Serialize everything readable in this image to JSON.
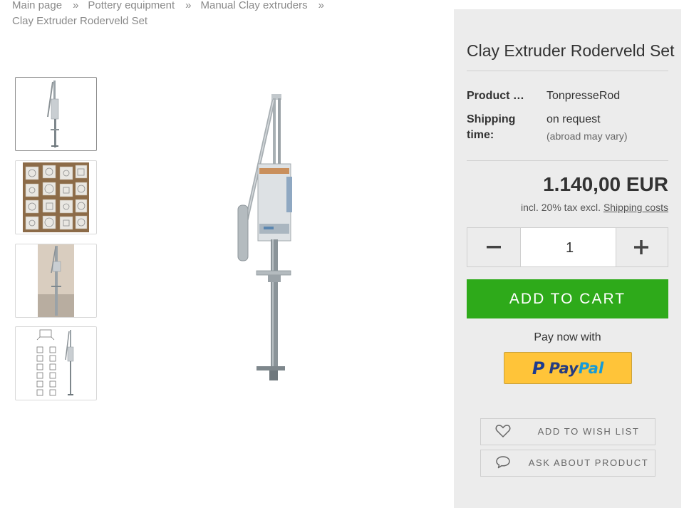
{
  "breadcrumb": {
    "items": [
      "Main page",
      "Pottery equipment",
      "Manual Clay extruders"
    ],
    "separator": "»",
    "current": "Clay Extruder Roderveld Set"
  },
  "gallery": {
    "thumbnails": [
      "extruder-photo",
      "dies-photo",
      "extruder-wall-photo",
      "extruder-with-dies-photo"
    ],
    "active_index": 0
  },
  "product": {
    "title": "Clay Extruder Roderveld Set",
    "product_label": "Product …",
    "product_value": "TonpresseRod",
    "shipping_label": "Shipping time:",
    "shipping_value": "on request",
    "shipping_note": "(abroad may vary)",
    "price": "1.140,00 EUR",
    "tax_text": "incl. 20% tax excl.",
    "shipping_costs_link": "Shipping costs"
  },
  "cart": {
    "quantity": "1",
    "minus_label": "−",
    "plus_label": "+",
    "add_to_cart": "ADD TO CART",
    "pay_now": "Pay now with",
    "paypal_part1": "Pay",
    "paypal_part2": "Pal"
  },
  "actions": {
    "wishlist": "ADD TO WISH LIST",
    "ask": "ASK ABOUT PRODUCT"
  },
  "colors": {
    "cart_button": "#2eaa1a",
    "paypal_bg": "#ffc439",
    "panel_bg": "#ececec"
  }
}
